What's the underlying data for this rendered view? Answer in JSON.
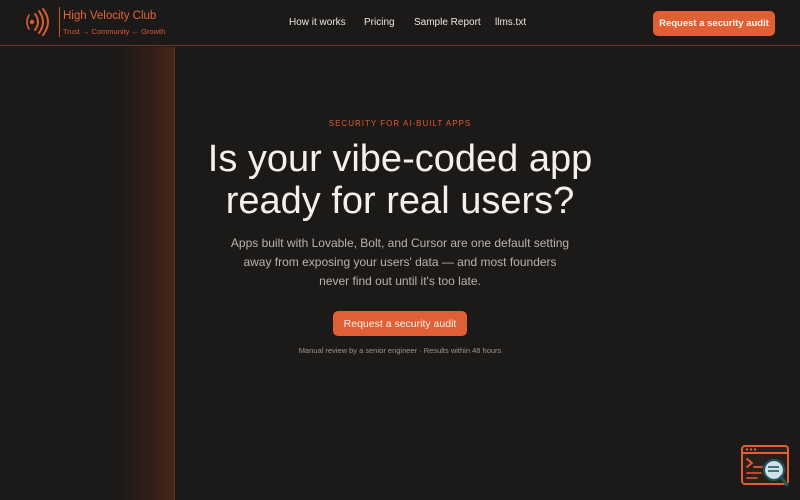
{
  "header": {
    "brand_name": "High Velocity Club",
    "tagline": "Trust → Community ← Growth",
    "logo_icon": "sound-waves-icon",
    "nav": [
      "How it works",
      "Pricing",
      "Sample Report",
      "llms.txt"
    ],
    "cta_label": "Request a security audit"
  },
  "hero": {
    "eyebrow": "SECURITY FOR AI-BUILT APPS",
    "headline_line1": "Is your vibe-coded app",
    "headline_line2": "ready for real users?",
    "subtext_line1": "Apps built with Lovable, Bolt, and Cursor are one default setting",
    "subtext_line2": "away from exposing your users' data — and most founders",
    "subtext_line3": "never find out until it's too late.",
    "cta_label": "Request a security audit",
    "footnote": "Manual review by a senior engineer · Results within 48 hours"
  },
  "widget": {
    "icon": "terminal-search-icon"
  },
  "colors": {
    "background": "#1c1a19",
    "accent": "#e05f34",
    "text_primary": "#f4f1ed",
    "text_secondary": "#b9b3ad"
  }
}
